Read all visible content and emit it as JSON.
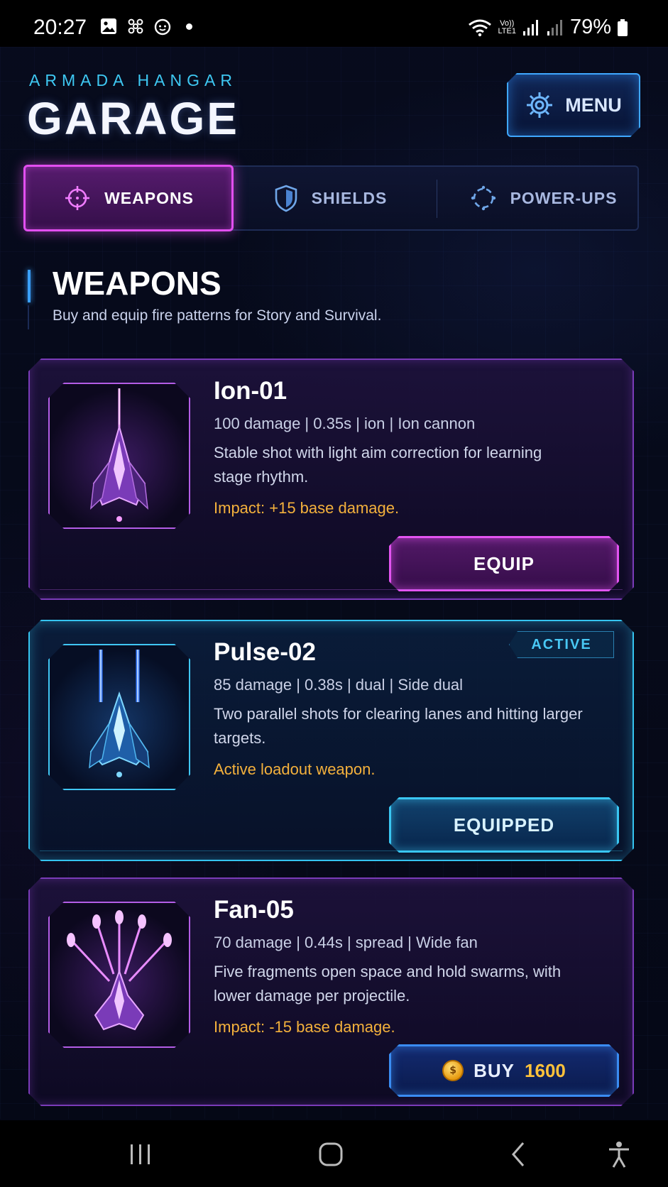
{
  "status_bar": {
    "time": "20:27",
    "battery": "79%",
    "volte_top": "Vo))",
    "volte_bottom": "LTE1"
  },
  "header": {
    "kicker": "ARMADA HANGAR",
    "title": "GARAGE",
    "menu_label": "MENU",
    "menu_icon": "gear-icon"
  },
  "tabs": [
    {
      "label": "WEAPONS",
      "icon": "crosshair-icon",
      "active": true
    },
    {
      "label": "SHIELDS",
      "icon": "shield-icon",
      "active": false
    },
    {
      "label": "POWER-UPS",
      "icon": "powerup-icon",
      "active": false
    }
  ],
  "section": {
    "title": "WEAPONS",
    "subtitle": "Buy and equip fire patterns for Story and Survival."
  },
  "weapons": [
    {
      "name": "Ion-01",
      "stats": "100 damage | 0.35s | ion | Ion cannon",
      "description": "Stable shot with light aim correction for learning stage rhythm.",
      "note": "Impact: +15 base damage.",
      "action": "EQUIP",
      "theme": "purple"
    },
    {
      "name": "Pulse-02",
      "stats": "85 damage | 0.38s | dual | Side dual",
      "description": "Two parallel shots for clearing lanes and hitting larger targets.",
      "note": "Active loadout weapon.",
      "badge": "ACTIVE",
      "action": "EQUIPPED",
      "theme": "cyan"
    },
    {
      "name": "Fan-05",
      "stats": "70 damage | 0.44s | spread | Wide fan",
      "description": "Five fragments open space and hold swarms, with lower damage per projectile.",
      "note": "Impact: -15 base damage.",
      "action": "BUY",
      "price": "1600",
      "theme": "purple"
    }
  ],
  "colors": {
    "accent_magenta": "#e24ff0",
    "accent_cyan": "#35c4f0",
    "accent_blue": "#3aa0ff",
    "impact_amber": "#f4b13c",
    "background": "#050816"
  },
  "nav_bar": {
    "items": [
      "recents-icon",
      "home-icon",
      "back-icon",
      "accessibility-icon"
    ]
  }
}
